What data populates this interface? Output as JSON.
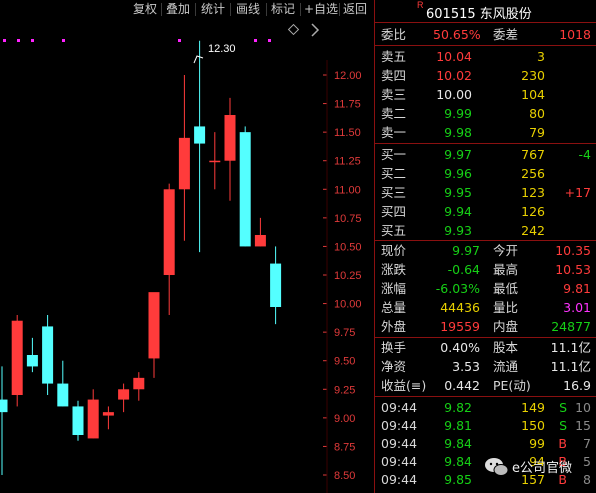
{
  "toolbar": {
    "buttons": [
      "复权",
      "叠加",
      "统计",
      "画线",
      "标记",
      "+自选",
      "返回"
    ]
  },
  "chart": {
    "high_label": "12.30",
    "y_ticks": [
      "12.00",
      "11.75",
      "11.50",
      "11.25",
      "11.00",
      "10.75",
      "10.50",
      "10.25",
      "10.00",
      "9.75",
      "9.50",
      "9.25",
      "9.00",
      "8.75",
      "8.50"
    ],
    "colors": {
      "up": "#ff3b3b",
      "down": "#54ffff",
      "ticks": "#e03a3a",
      "grid": "#5a0000",
      "marker": "#ff22ff"
    }
  },
  "chart_data": {
    "type": "candlestick",
    "ylim": [
      8.5,
      12.0
    ],
    "candles": [
      {
        "o": 9.16,
        "h": 9.45,
        "l": 8.5,
        "c": 9.05
      },
      {
        "o": 9.2,
        "h": 9.9,
        "l": 9.1,
        "c": 9.85
      },
      {
        "o": 9.55,
        "h": 9.7,
        "l": 9.4,
        "c": 9.45
      },
      {
        "o": 9.8,
        "h": 9.9,
        "l": 9.2,
        "c": 9.3
      },
      {
        "o": 9.3,
        "h": 9.5,
        "l": 9.1,
        "c": 9.1
      },
      {
        "o": 9.1,
        "h": 9.15,
        "l": 8.8,
        "c": 8.85
      },
      {
        "o": 8.82,
        "h": 9.25,
        "l": 8.82,
        "c": 9.16
      },
      {
        "o": 9.02,
        "h": 9.1,
        "l": 8.9,
        "c": 9.05
      },
      {
        "o": 9.16,
        "h": 9.3,
        "l": 9.05,
        "c": 9.25
      },
      {
        "o": 9.25,
        "h": 9.4,
        "l": 9.15,
        "c": 9.35
      },
      {
        "o": 9.52,
        "h": 9.65,
        "l": 9.35,
        "c": 10.1
      },
      {
        "o": 10.25,
        "h": 11.05,
        "l": 9.9,
        "c": 11.0
      },
      {
        "o": 11.0,
        "h": 12.0,
        "l": 10.55,
        "c": 11.45
      },
      {
        "o": 11.55,
        "h": 12.3,
        "l": 10.45,
        "c": 11.4
      },
      {
        "o": 11.25,
        "h": 11.5,
        "l": 11.0,
        "c": 11.25
      },
      {
        "o": 11.25,
        "h": 11.8,
        "l": 10.9,
        "c": 11.65
      },
      {
        "o": 11.5,
        "h": 11.55,
        "l": 10.5,
        "c": 10.5
      },
      {
        "o": 10.5,
        "h": 10.75,
        "l": 10.5,
        "c": 10.6
      },
      {
        "o": 10.35,
        "h": 10.5,
        "l": 9.82,
        "c": 9.97
      }
    ]
  },
  "quote": {
    "code": "601515",
    "name": "东风股份",
    "badge": "R",
    "weibi_label": "委比",
    "weibi_value": "50.65%",
    "weicha_label": "委差",
    "weicha_value": "1018",
    "asks": [
      {
        "label": "卖五",
        "price": "10.04",
        "vol": "3"
      },
      {
        "label": "卖四",
        "price": "10.02",
        "vol": "230"
      },
      {
        "label": "卖三",
        "price": "10.00",
        "vol": "104"
      },
      {
        "label": "卖二",
        "price": "9.99",
        "vol": "80"
      },
      {
        "label": "卖一",
        "price": "9.98",
        "vol": "79"
      }
    ],
    "bids": [
      {
        "label": "买一",
        "price": "9.97",
        "vol": "767",
        "delta": "-4"
      },
      {
        "label": "买二",
        "price": "9.96",
        "vol": "256",
        "delta": ""
      },
      {
        "label": "买三",
        "price": "9.95",
        "vol": "123",
        "delta": "+17"
      },
      {
        "label": "买四",
        "price": "9.94",
        "vol": "126",
        "delta": ""
      },
      {
        "label": "买五",
        "price": "9.93",
        "vol": "242",
        "delta": ""
      }
    ],
    "stats": [
      {
        "l1": "现价",
        "v1": "9.97",
        "l2": "今开",
        "v2": "10.35"
      },
      {
        "l1": "涨跌",
        "v1": "-0.64",
        "l2": "最高",
        "v2": "10.53"
      },
      {
        "l1": "涨幅",
        "v1": "-6.03%",
        "l2": "最低",
        "v2": "9.81"
      },
      {
        "l1": "总量",
        "v1": "44436",
        "l2": "量比",
        "v2": "3.01"
      },
      {
        "l1": "外盘",
        "v1": "19559",
        "l2": "内盘",
        "v2": "24877"
      }
    ],
    "fund": [
      {
        "l1": "换手",
        "v1": "0.40%",
        "l2": "股本",
        "v2": "11.1亿"
      },
      {
        "l1": "净资",
        "v1": "3.53",
        "l2": "流通",
        "v2": "11.1亿"
      },
      {
        "l1": "收益(≡)",
        "v1": "0.442",
        "l2": "PE(动)",
        "v2": "16.9"
      }
    ],
    "ticks": [
      {
        "time": "09:44",
        "price": "9.82",
        "vol": "149",
        "bs": "S",
        "n": "10"
      },
      {
        "time": "09:44",
        "price": "9.81",
        "vol": "150",
        "bs": "S",
        "n": "15"
      },
      {
        "time": "09:44",
        "price": "9.84",
        "vol": "99",
        "bs": "B",
        "n": "7"
      },
      {
        "time": "09:44",
        "price": "9.84",
        "vol": "94",
        "bs": "B",
        "n": "5"
      },
      {
        "time": "09:44",
        "price": "9.85",
        "vol": "157",
        "bs": "B",
        "n": "8"
      }
    ]
  },
  "watermark": {
    "text": "e公司官微"
  }
}
